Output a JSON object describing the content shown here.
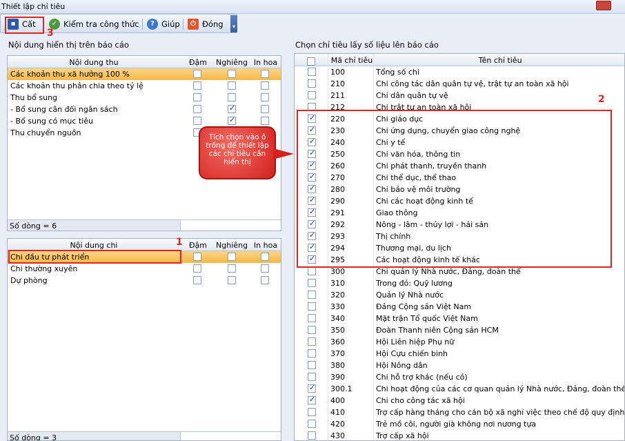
{
  "window": {
    "title": "Thiết lập chỉ tiêu"
  },
  "toolbar": {
    "save_label": "Cất",
    "check_label": "Kiểm tra công thức",
    "help_label": "Giúp",
    "close_label": "Đóng"
  },
  "annotations": {
    "n1": "1",
    "n2": "2",
    "n3": "3"
  },
  "tooltip": "Tích chọn vào ô trống để thiết lập các chỉ tiêu cần hiển thị",
  "left": {
    "section_title": "Nội dung hiển thị trên báo cáo",
    "income": {
      "headers": {
        "name": "Nội dung thu",
        "bold": "Đậm",
        "italic": "Nghiêng",
        "upper": "In hoa"
      },
      "rows": [
        {
          "name": "Các khoản thu xã hưởng 100 %",
          "bold": false,
          "italic": false,
          "upper": false,
          "selected": true
        },
        {
          "name": "Các khoản thu phân chia theo tỷ lệ",
          "bold": false,
          "italic": false,
          "upper": false
        },
        {
          "name": "Thu bổ sung",
          "bold": false,
          "italic": false,
          "upper": false
        },
        {
          "name": "- Bổ sung cân đối ngân sách",
          "bold": false,
          "italic": true,
          "upper": false
        },
        {
          "name": "- Bổ sung có mục tiêu",
          "bold": false,
          "italic": true,
          "upper": false
        },
        {
          "name": "Thu chuyển nguồn",
          "bold": false,
          "italic": false,
          "upper": false
        }
      ],
      "footer": "Số dòng = 6"
    },
    "expense": {
      "headers": {
        "name": "Nội dung chi",
        "bold": "Đậm",
        "italic": "Nghiêng",
        "upper": "In hoa"
      },
      "rows": [
        {
          "name": "Chi đầu tư phát triển",
          "bold": false,
          "italic": false,
          "upper": false,
          "selected": true
        },
        {
          "name": "Chi thường xuyên",
          "bold": false,
          "italic": false,
          "upper": false
        },
        {
          "name": "Dự phòng",
          "bold": false,
          "italic": false,
          "upper": false
        }
      ],
      "footer": "Số dòng = 3"
    }
  },
  "right": {
    "section_title": "Chọn chỉ tiêu lấy số liệu lên báo cáo",
    "headers": {
      "code": "Mã chỉ tiêu",
      "name": "Tên chỉ tiêu"
    },
    "rows": [
      {
        "code": "100",
        "name": "Tổng số chi",
        "checked": false
      },
      {
        "code": "210",
        "name": "Chi công tác dân quân tự vệ, trật tự an toàn xã hội",
        "checked": false
      },
      {
        "code": "211",
        "name": "Chi dân quân tự vệ",
        "checked": false
      },
      {
        "code": "212",
        "name": "Chi trật tự an toàn xã hội",
        "checked": false
      },
      {
        "code": "220",
        "name": "Chi giáo dục",
        "checked": true
      },
      {
        "code": "230",
        "name": "Chi ứng dụng, chuyển giao công nghệ",
        "checked": true
      },
      {
        "code": "240",
        "name": "Chi y tế",
        "checked": true
      },
      {
        "code": "250",
        "name": "Chi văn hóa, thông tin",
        "checked": true
      },
      {
        "code": "260",
        "name": "Chi phát thanh, truyền thanh",
        "checked": true
      },
      {
        "code": "270",
        "name": "Chi thể dục, thể thao",
        "checked": true
      },
      {
        "code": "280",
        "name": "Chi bảo vệ môi trường",
        "checked": true
      },
      {
        "code": "290",
        "name": "Chi các hoạt động kinh tế",
        "checked": true
      },
      {
        "code": "291",
        "name": "Giao thông",
        "checked": true
      },
      {
        "code": "292",
        "name": "Nông - lâm - thủy lợi - hải sản",
        "checked": true
      },
      {
        "code": "293",
        "name": "Thị chính",
        "checked": true
      },
      {
        "code": "294",
        "name": "Thương mại, du lịch",
        "checked": true
      },
      {
        "code": "295",
        "name": "Các hoạt động kinh tế khác",
        "checked": true
      },
      {
        "code": "300",
        "name": "Chi quản lý Nhà nước, Đảng, đoàn thể",
        "checked": false
      },
      {
        "code": "310",
        "name": "Trong đó: Quỹ lương",
        "checked": false
      },
      {
        "code": "320",
        "name": "Quản lý Nhà nước",
        "checked": false
      },
      {
        "code": "330",
        "name": "Đảng Cộng sản Việt Nam",
        "checked": false
      },
      {
        "code": "340",
        "name": "Mặt trận Tổ quốc Việt Nam",
        "checked": false
      },
      {
        "code": "350",
        "name": "Đoàn Thanh niên Cộng sản HCM",
        "checked": false
      },
      {
        "code": "360",
        "name": "Hội Liên hiệp Phụ nữ",
        "checked": false
      },
      {
        "code": "370",
        "name": "Hội Cựu chiến binh",
        "checked": false
      },
      {
        "code": "380",
        "name": "Hội Nông dân",
        "checked": false
      },
      {
        "code": "390",
        "name": "Chi hỗ trợ khác (nếu có)",
        "checked": false
      },
      {
        "code": "300.1",
        "name": "Chi hoạt động của các cơ quan quản lý Nhà nước, Đảng, đoàn thể",
        "checked": true
      },
      {
        "code": "400",
        "name": "Chi cho công tác xã hội",
        "checked": true
      },
      {
        "code": "410",
        "name": "Trợ cấp hàng tháng cho cán bộ xã nghỉ việc theo chế độ quy định và t...",
        "checked": false
      },
      {
        "code": "420",
        "name": "Trẻ mồ côi, người già không nơi nương tựa",
        "checked": false
      },
      {
        "code": "430",
        "name": "Trợ cấp xã hội",
        "checked": false
      }
    ]
  }
}
